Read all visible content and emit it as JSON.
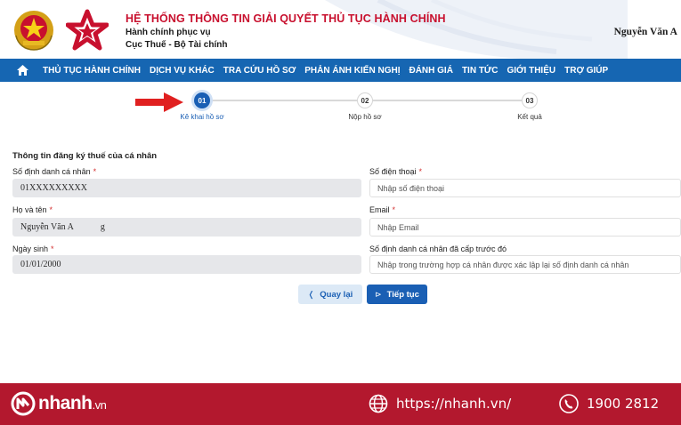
{
  "header": {
    "title": "HỆ THỐNG THÔNG TIN GIẢI QUYẾT THỦ TỤC HÀNH CHÍNH",
    "subtitle_1": "Hành chính phục vụ",
    "subtitle_2": "Cục Thuế - Bộ Tài chính",
    "user_name": "Nguyễn Văn A"
  },
  "nav": {
    "items": [
      "THỦ TỤC HÀNH CHÍNH",
      "DỊCH VỤ KHÁC",
      "TRA CỨU HỒ SƠ",
      "PHẢN ÁNH KIẾN NGHỊ",
      "ĐÁNH GIÁ",
      "TIN TỨC",
      "GIỚI THIỆU",
      "TRỢ GIÚP"
    ]
  },
  "stepper": {
    "steps": [
      {
        "number": "01",
        "label": "Kê khai hồ sơ",
        "active": true
      },
      {
        "number": "02",
        "label": "Nộp hồ sơ",
        "active": false
      },
      {
        "number": "03",
        "label": "Kết quả",
        "active": false
      }
    ]
  },
  "form": {
    "section_title": "Thông tin đăng ký thuế của cá nhân",
    "fields": {
      "id_number": {
        "label": "Số định danh cá nhân",
        "value": "01XXXXXXXXX"
      },
      "full_name": {
        "label": "Họ và tên",
        "value": "Nguyễn Văn A",
        "suffix": "g"
      },
      "dob": {
        "label": "Ngày sinh",
        "value": "01/01/2000"
      },
      "phone": {
        "label": "Số điện thoại",
        "placeholder": "Nhập số điện thoại"
      },
      "email": {
        "label": "Email",
        "placeholder": "Nhập Email"
      },
      "prev_id": {
        "label": "Số định danh cá nhân đã cấp trước đó",
        "placeholder": "Nhập trong trường hợp cá nhân được xác lập lại số định danh cá nhân"
      }
    },
    "required_mark": "*"
  },
  "buttons": {
    "back": "Quay lại",
    "next": "Tiếp tục"
  },
  "footer": {
    "brand": "nhanh",
    "brand_suffix": ".vn",
    "website": "https://nhanh.vn/",
    "phone": "1900 2812"
  },
  "colors": {
    "nav_blue": "#1666b2",
    "primary": "#1a5fb4",
    "title_red": "#c8102e",
    "footer_red": "#b3182e"
  }
}
